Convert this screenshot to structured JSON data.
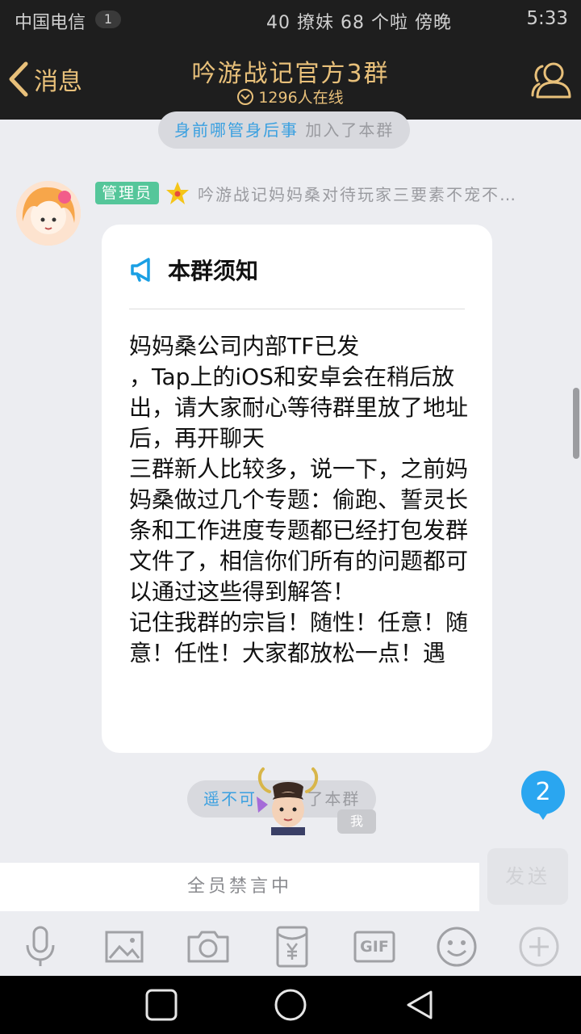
{
  "status_bar": {
    "carrier": "中国电信",
    "sim_badge": "1",
    "indicators": "40 撩妹 68 个啦 傍晚",
    "time": "5:33"
  },
  "header": {
    "back_label": "消息",
    "title": "吟游战记官方3群",
    "subtitle": "1296人在线",
    "accent_color": "#e8c07a"
  },
  "system_notices": [
    {
      "name": "身前哪管身后事",
      "text": " 加入了本群"
    },
    {
      "name": "遥不可",
      "text": " 了本群"
    }
  ],
  "message": {
    "badge": "管理员",
    "sender_name": "吟游战记妈妈桑对待玩家三要素不宠不…",
    "notice_title": "本群须知",
    "notice_body": "妈妈桑公司内部TF已发\n，Tap上的iOS和安卓会在稍后放出，请大家耐心等待群里放了地址后，再开聊天\n三群新人比较多，说一下，之前妈妈桑做过几个专题：偷跑、誓灵长条和工作进度专题都已经打包发群文件了，相信你们所有的问题都可以通过这些得到解答！\n记住我群的宗旨！随性！任意！随意！任性！大家都放松一点！遇"
  },
  "unread_count": "2",
  "me_tag": "我",
  "input": {
    "placeholder": "全员禁言中",
    "send_label": "发送"
  },
  "toolbar": {
    "gif_label": "GIF",
    "icons": [
      "microphone-icon",
      "image-icon",
      "camera-icon",
      "red-packet-icon",
      "gif-icon",
      "emoji-icon",
      "plus-icon"
    ]
  },
  "system_nav": [
    "recents-icon",
    "home-icon",
    "back-icon"
  ]
}
